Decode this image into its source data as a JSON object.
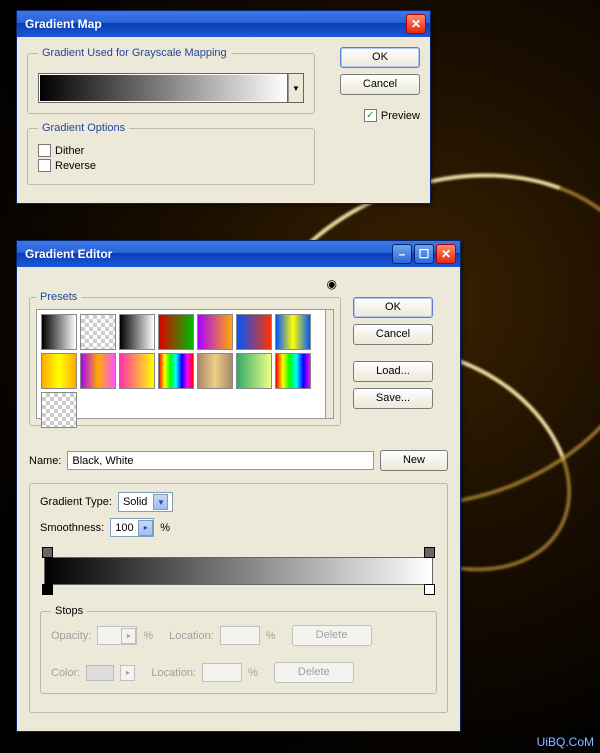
{
  "gmap": {
    "title": "Gradient Map",
    "legend_mapping": "Gradient Used for Grayscale Mapping",
    "ok": "OK",
    "cancel": "Cancel",
    "preview_label": "Preview",
    "preview_checked": "✓",
    "legend_options": "Gradient Options",
    "dither": "Dither",
    "reverse": "Reverse"
  },
  "ed": {
    "title": "Gradient Editor",
    "presets_label": "Presets",
    "ok": "OK",
    "cancel": "Cancel",
    "load": "Load...",
    "save": "Save...",
    "name_label": "Name:",
    "name_value": "Black, White",
    "new": "New",
    "grad_type_label": "Gradient Type:",
    "grad_type_value": "Solid",
    "smooth_label": "Smoothness:",
    "smooth_value": "100",
    "smooth_pct": "%",
    "stops_legend": "Stops",
    "opacity_label": "Opacity:",
    "location_label": "Location:",
    "delete": "Delete",
    "color_label": "Color:",
    "pct": "%",
    "presets": [
      {
        "css": "linear-gradient(to right,#000,#fff)"
      },
      {
        "css": "repeating-conic-gradient(#ccc 0 25%, #fff 0 50%)",
        "bs": "8px 8px"
      },
      {
        "css": "linear-gradient(to right,#000,#fff)"
      },
      {
        "css": "linear-gradient(to right,#d00,#0b0)"
      },
      {
        "css": "linear-gradient(to right,#a0f,#fa0)"
      },
      {
        "css": "linear-gradient(to right,#05f,#f30)"
      },
      {
        "css": "linear-gradient(to right,#05f,#ff0,#05f)"
      },
      {
        "css": "linear-gradient(to right,#fa0,#ff0,#fa0)"
      },
      {
        "css": "linear-gradient(to right,#a0f,#fa0,#f5f)"
      },
      {
        "css": "linear-gradient(to right,#f3a,#ff0)"
      },
      {
        "css": "linear-gradient(to right,#f00,#ff0,#0f0,#0ff,#00f,#f0f,#f00)"
      },
      {
        "css": "linear-gradient(to right,#a86,#ec8,#a86)"
      },
      {
        "css": "linear-gradient(to right,#3a6,#ef8)"
      },
      {
        "css": "linear-gradient(to right,#f00,#ff0,#0f0,#0ff,#00f,#f0f)"
      },
      {
        "css": "repeating-conic-gradient(#ccc 0 25%, #fff 0 50%)",
        "bs": "8px 8px"
      }
    ]
  },
  "watermark": "UiBQ.CoM"
}
